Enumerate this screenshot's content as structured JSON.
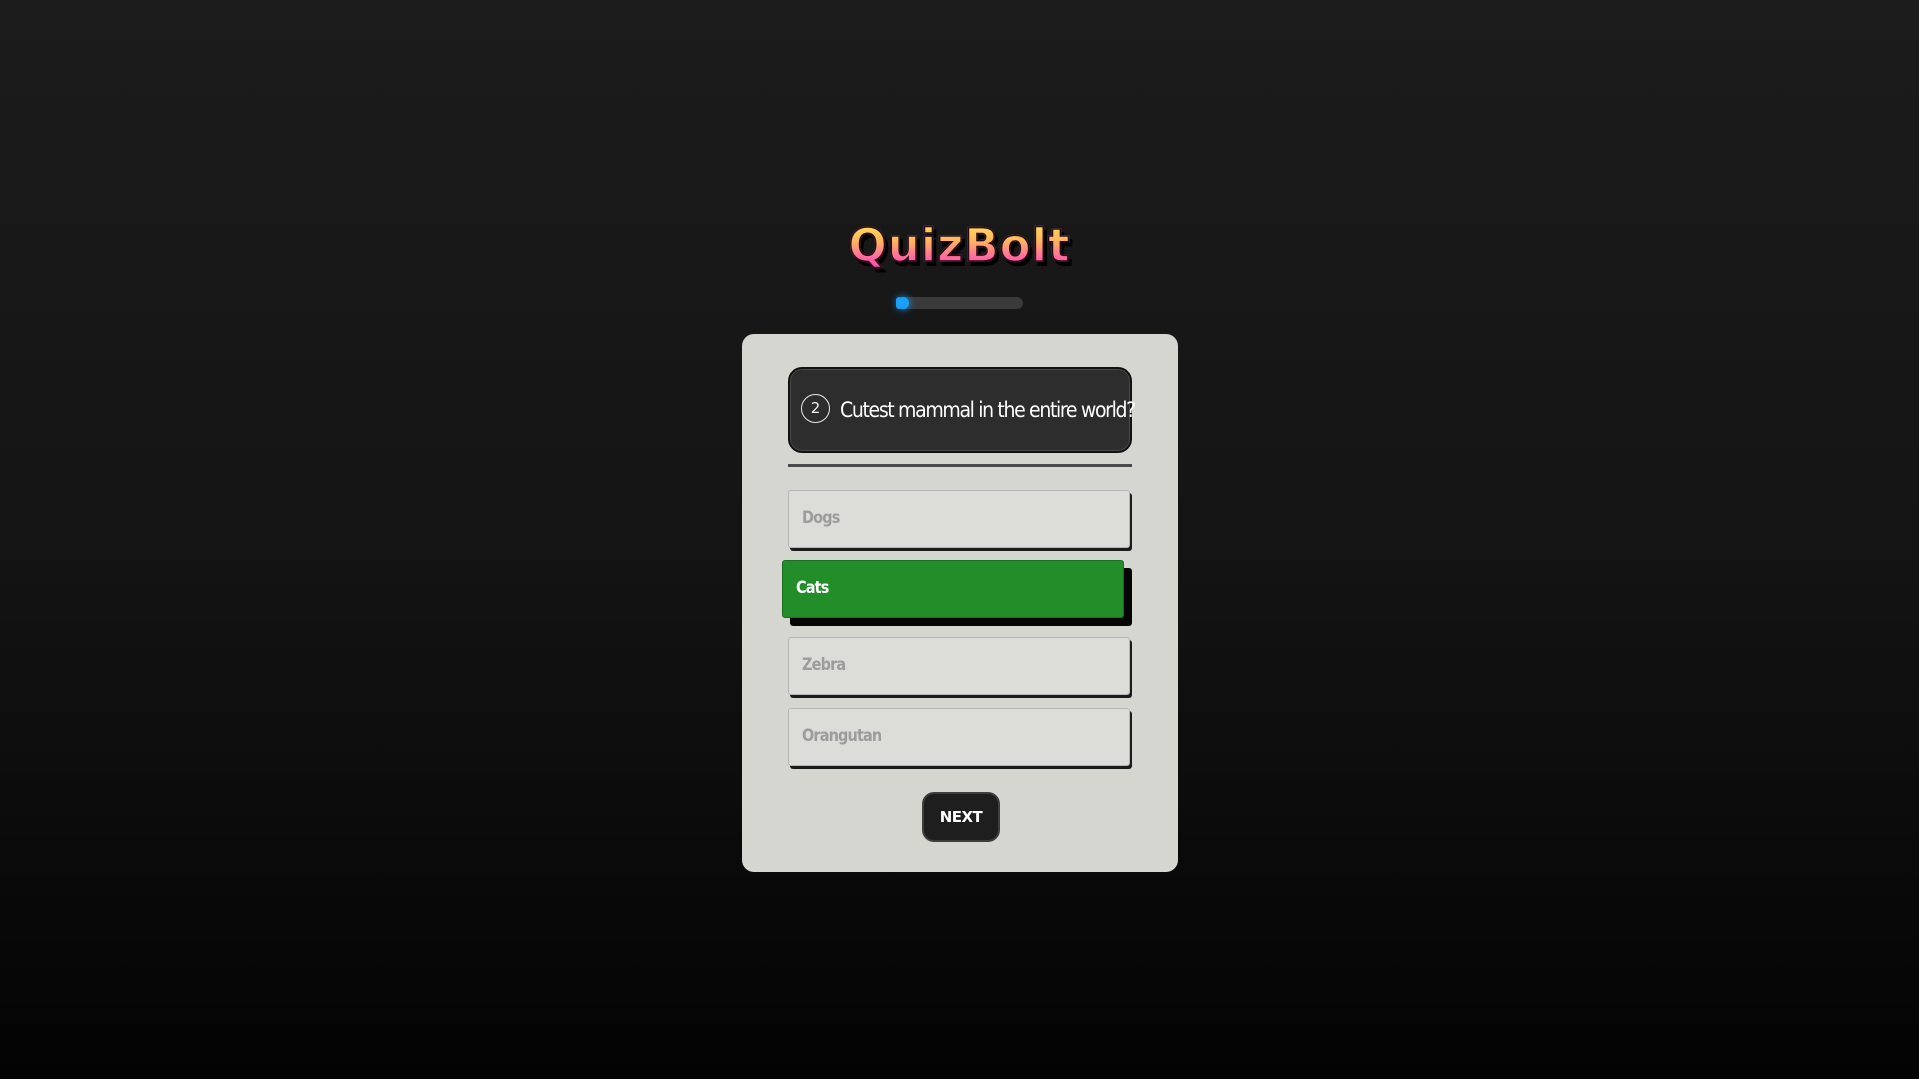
{
  "app": {
    "title": "QuizBolt",
    "accent_color": "#1f9bef",
    "selected_color": "#238e29"
  },
  "progress": {
    "value_percent": 5
  },
  "question": {
    "number": "2",
    "text": "Cutest mammal in the entire world?"
  },
  "options": [
    {
      "label": "Dogs",
      "selected": false
    },
    {
      "label": "Cats",
      "selected": true
    },
    {
      "label": "Zebra",
      "selected": false
    },
    {
      "label": "Orangutan",
      "selected": false
    }
  ],
  "actions": {
    "next_label": "NEXT"
  }
}
